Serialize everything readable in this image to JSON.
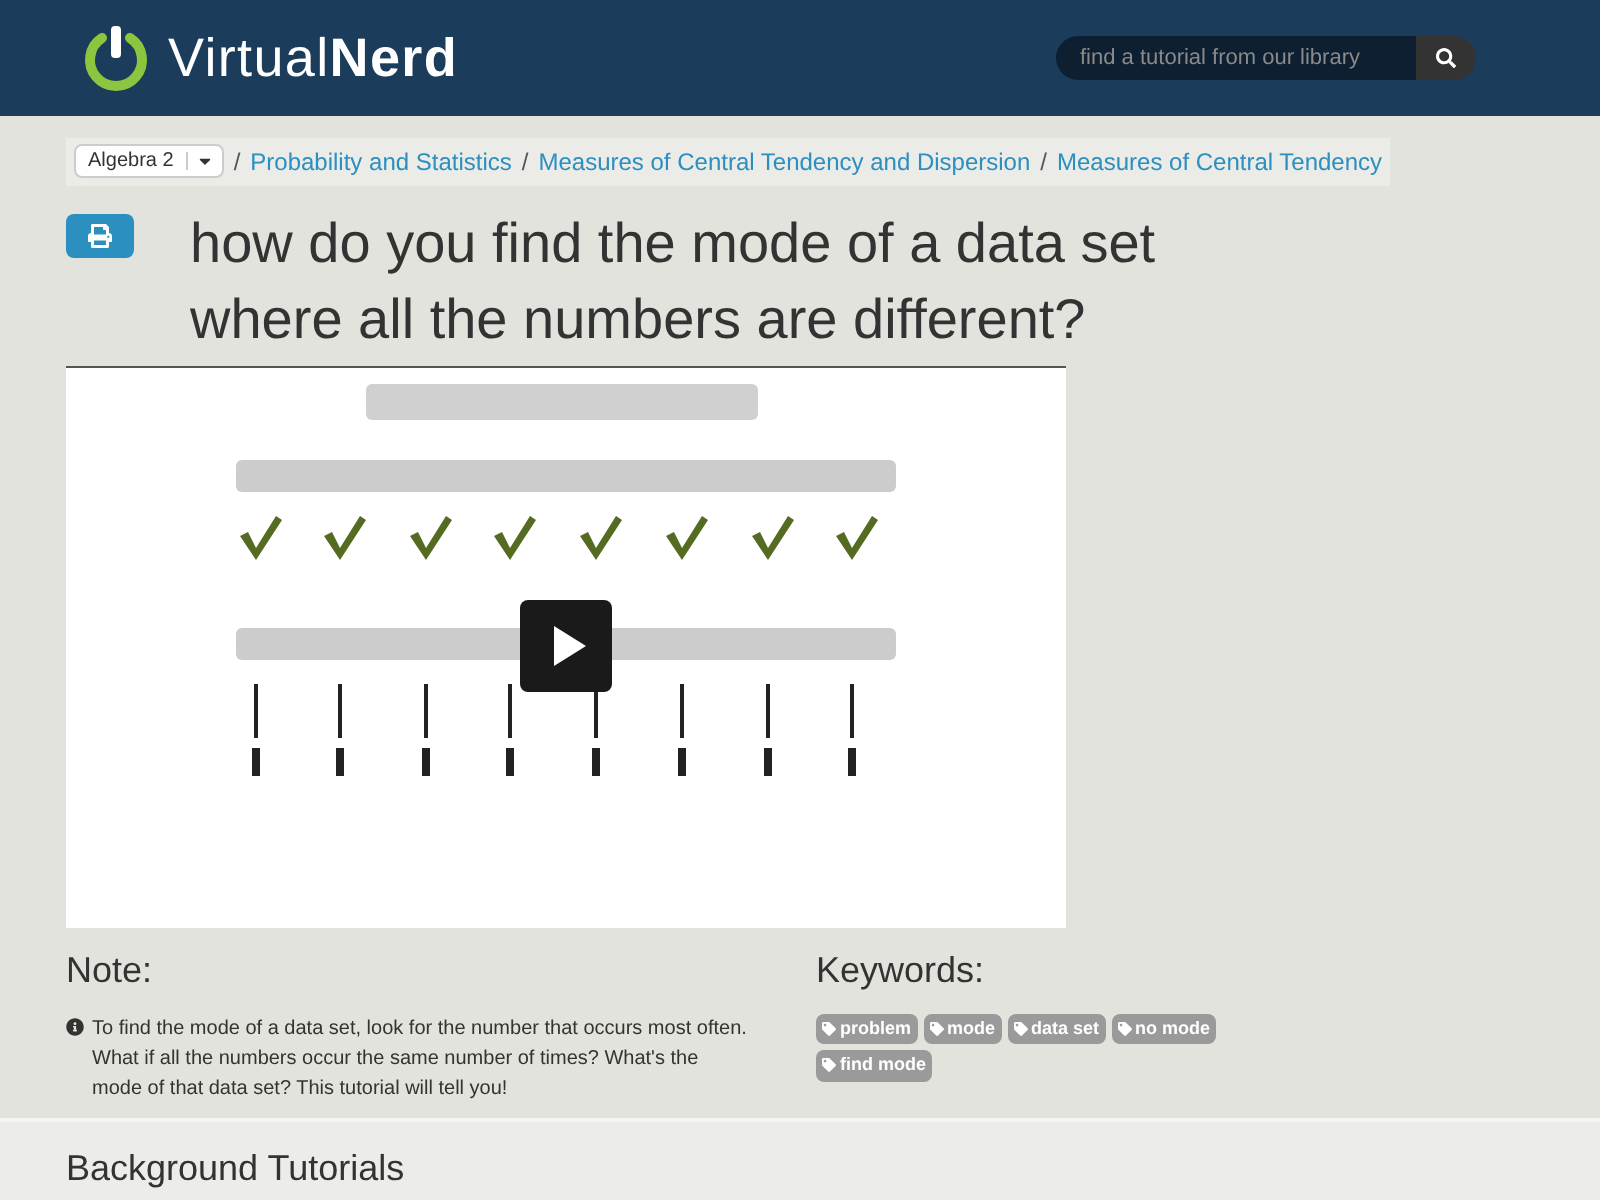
{
  "header": {
    "logo": {
      "light": "Virtual",
      "bold": "Nerd"
    },
    "search": {
      "placeholder": "find a tutorial from our library"
    }
  },
  "breadcrumb": {
    "course": "Algebra 2",
    "links": [
      "Probability and Statistics",
      "Measures of Central Tendency and Dispersion",
      "Measures of Central Tendency"
    ],
    "separator": "/"
  },
  "title": "how do you find the mode of a data set where all the numbers are different?",
  "note": {
    "heading": "Note:",
    "text": "To find the mode of a data set, look for the number that occurs most often. What if all the numbers occur the same number of times? What's the mode of that data set? This tutorial will tell you!"
  },
  "keywords": {
    "heading": "Keywords:",
    "tags": [
      "problem",
      "mode",
      "data set",
      "no mode",
      "find mode"
    ]
  },
  "background_heading": "Background Tutorials"
}
